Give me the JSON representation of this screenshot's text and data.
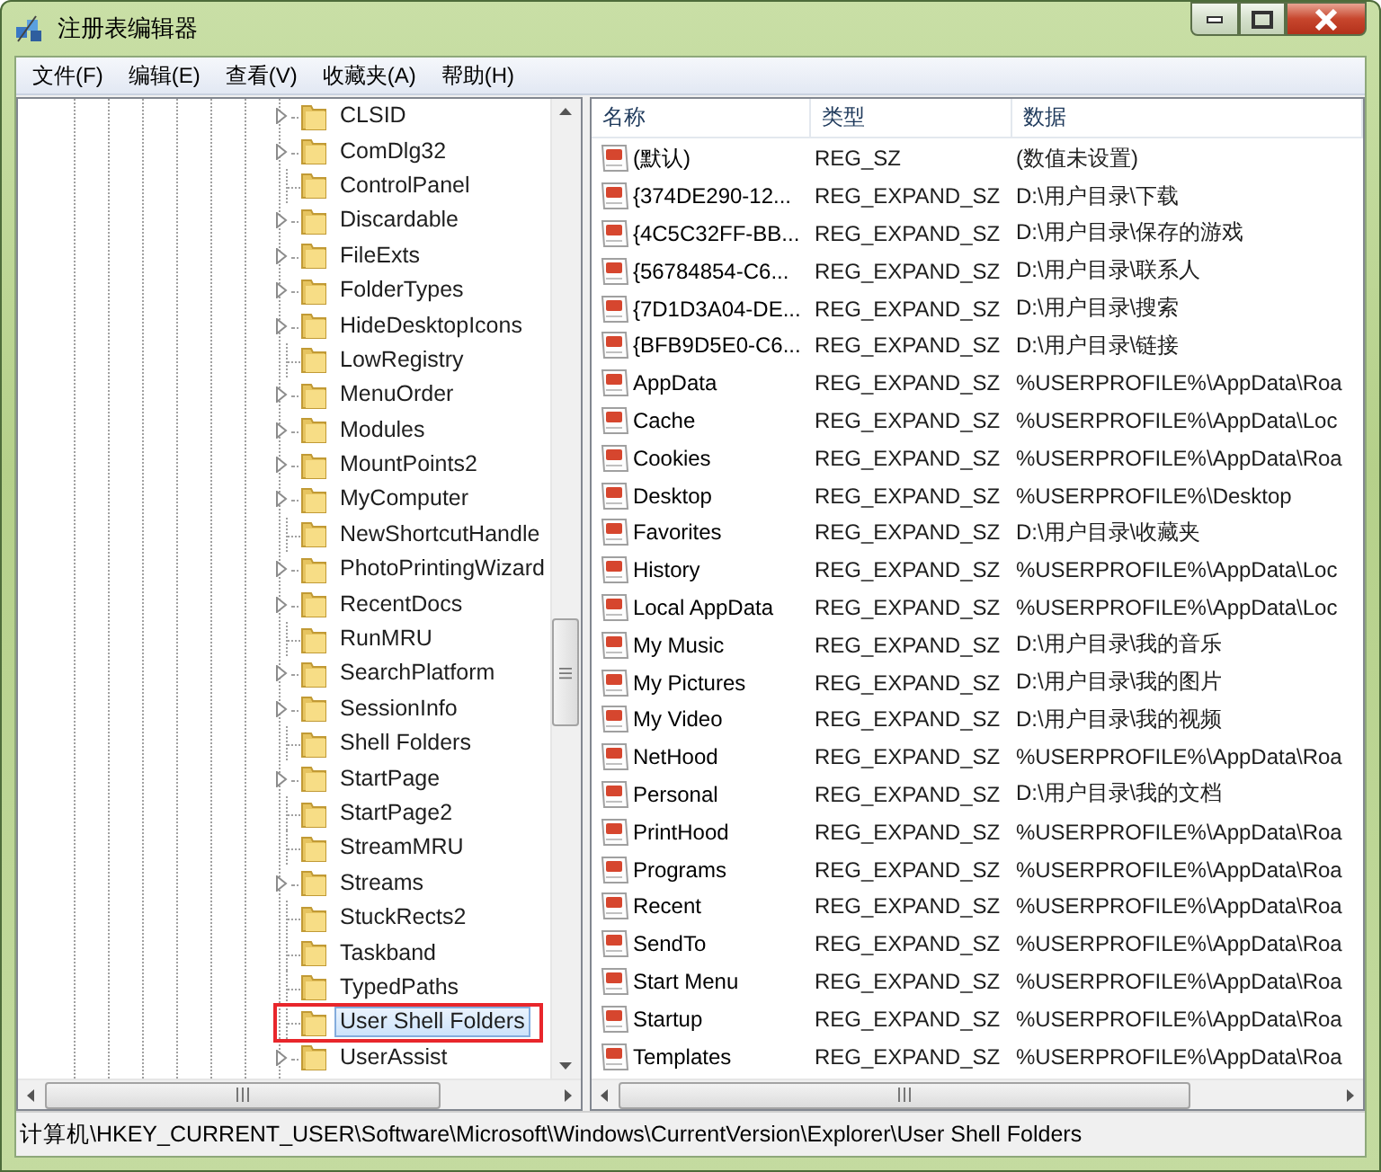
{
  "window": {
    "title": "注册表编辑器"
  },
  "menu": [
    "文件(F)",
    "编辑(E)",
    "查看(V)",
    "收藏夹(A)",
    "帮助(H)"
  ],
  "tree": {
    "items": [
      {
        "label": "CLSID",
        "has_children": true,
        "selected": false
      },
      {
        "label": "ComDlg32",
        "has_children": true,
        "selected": false
      },
      {
        "label": "ControlPanel",
        "has_children": false,
        "selected": false
      },
      {
        "label": "Discardable",
        "has_children": true,
        "selected": false
      },
      {
        "label": "FileExts",
        "has_children": true,
        "selected": false
      },
      {
        "label": "FolderTypes",
        "has_children": true,
        "selected": false
      },
      {
        "label": "HideDesktopIcons",
        "has_children": true,
        "selected": false
      },
      {
        "label": "LowRegistry",
        "has_children": false,
        "selected": false
      },
      {
        "label": "MenuOrder",
        "has_children": true,
        "selected": false
      },
      {
        "label": "Modules",
        "has_children": true,
        "selected": false
      },
      {
        "label": "MountPoints2",
        "has_children": true,
        "selected": false
      },
      {
        "label": "MyComputer",
        "has_children": true,
        "selected": false
      },
      {
        "label": "NewShortcutHandle",
        "has_children": false,
        "selected": false
      },
      {
        "label": "PhotoPrintingWizard",
        "has_children": true,
        "selected": false
      },
      {
        "label": "RecentDocs",
        "has_children": true,
        "selected": false
      },
      {
        "label": "RunMRU",
        "has_children": false,
        "selected": false
      },
      {
        "label": "SearchPlatform",
        "has_children": true,
        "selected": false
      },
      {
        "label": "SessionInfo",
        "has_children": true,
        "selected": false
      },
      {
        "label": "Shell Folders",
        "has_children": false,
        "selected": false
      },
      {
        "label": "StartPage",
        "has_children": true,
        "selected": false
      },
      {
        "label": "StartPage2",
        "has_children": false,
        "selected": false
      },
      {
        "label": "StreamMRU",
        "has_children": false,
        "selected": false
      },
      {
        "label": "Streams",
        "has_children": true,
        "selected": false
      },
      {
        "label": "StuckRects2",
        "has_children": false,
        "selected": false
      },
      {
        "label": "Taskband",
        "has_children": false,
        "selected": false
      },
      {
        "label": "TypedPaths",
        "has_children": false,
        "selected": false
      },
      {
        "label": "User Shell Folders",
        "has_children": false,
        "selected": true
      },
      {
        "label": "UserAssist",
        "has_children": true,
        "selected": false
      }
    ]
  },
  "table": {
    "columns": [
      "名称",
      "类型",
      "数据"
    ],
    "rows": [
      [
        "(默认)",
        "REG_SZ",
        "(数值未设置)"
      ],
      [
        "{374DE290-12...",
        "REG_EXPAND_SZ",
        "D:\\用户目录\\下载"
      ],
      [
        "{4C5C32FF-BB...",
        "REG_EXPAND_SZ",
        "D:\\用户目录\\保存的游戏"
      ],
      [
        "{56784854-C6...",
        "REG_EXPAND_SZ",
        "D:\\用户目录\\联系人"
      ],
      [
        "{7D1D3A04-DE...",
        "REG_EXPAND_SZ",
        "D:\\用户目录\\搜索"
      ],
      [
        "{BFB9D5E0-C6...",
        "REG_EXPAND_SZ",
        "D:\\用户目录\\链接"
      ],
      [
        "AppData",
        "REG_EXPAND_SZ",
        "%USERPROFILE%\\AppData\\Roa"
      ],
      [
        "Cache",
        "REG_EXPAND_SZ",
        "%USERPROFILE%\\AppData\\Loc"
      ],
      [
        "Cookies",
        "REG_EXPAND_SZ",
        "%USERPROFILE%\\AppData\\Roa"
      ],
      [
        "Desktop",
        "REG_EXPAND_SZ",
        "%USERPROFILE%\\Desktop"
      ],
      [
        "Favorites",
        "REG_EXPAND_SZ",
        "D:\\用户目录\\收藏夹"
      ],
      [
        "History",
        "REG_EXPAND_SZ",
        "%USERPROFILE%\\AppData\\Loc"
      ],
      [
        "Local AppData",
        "REG_EXPAND_SZ",
        "%USERPROFILE%\\AppData\\Loc"
      ],
      [
        "My Music",
        "REG_EXPAND_SZ",
        "D:\\用户目录\\我的音乐"
      ],
      [
        "My Pictures",
        "REG_EXPAND_SZ",
        "D:\\用户目录\\我的图片"
      ],
      [
        "My Video",
        "REG_EXPAND_SZ",
        "D:\\用户目录\\我的视频"
      ],
      [
        "NetHood",
        "REG_EXPAND_SZ",
        "%USERPROFILE%\\AppData\\Roa"
      ],
      [
        "Personal",
        "REG_EXPAND_SZ",
        "D:\\用户目录\\我的文档"
      ],
      [
        "PrintHood",
        "REG_EXPAND_SZ",
        "%USERPROFILE%\\AppData\\Roa"
      ],
      [
        "Programs",
        "REG_EXPAND_SZ",
        "%USERPROFILE%\\AppData\\Roa"
      ],
      [
        "Recent",
        "REG_EXPAND_SZ",
        "%USERPROFILE%\\AppData\\Roa"
      ],
      [
        "SendTo",
        "REG_EXPAND_SZ",
        "%USERPROFILE%\\AppData\\Roa"
      ],
      [
        "Start Menu",
        "REG_EXPAND_SZ",
        "%USERPROFILE%\\AppData\\Roa"
      ],
      [
        "Startup",
        "REG_EXPAND_SZ",
        "%USERPROFILE%\\AppData\\Roa"
      ],
      [
        "Templates",
        "REG_EXPAND_SZ",
        "%USERPROFILE%\\AppData\\Roa"
      ]
    ]
  },
  "status_bar": "计算机\\HKEY_CURRENT_USER\\Software\\Microsoft\\Windows\\CurrentVersion\\Explorer\\User Shell Folders"
}
